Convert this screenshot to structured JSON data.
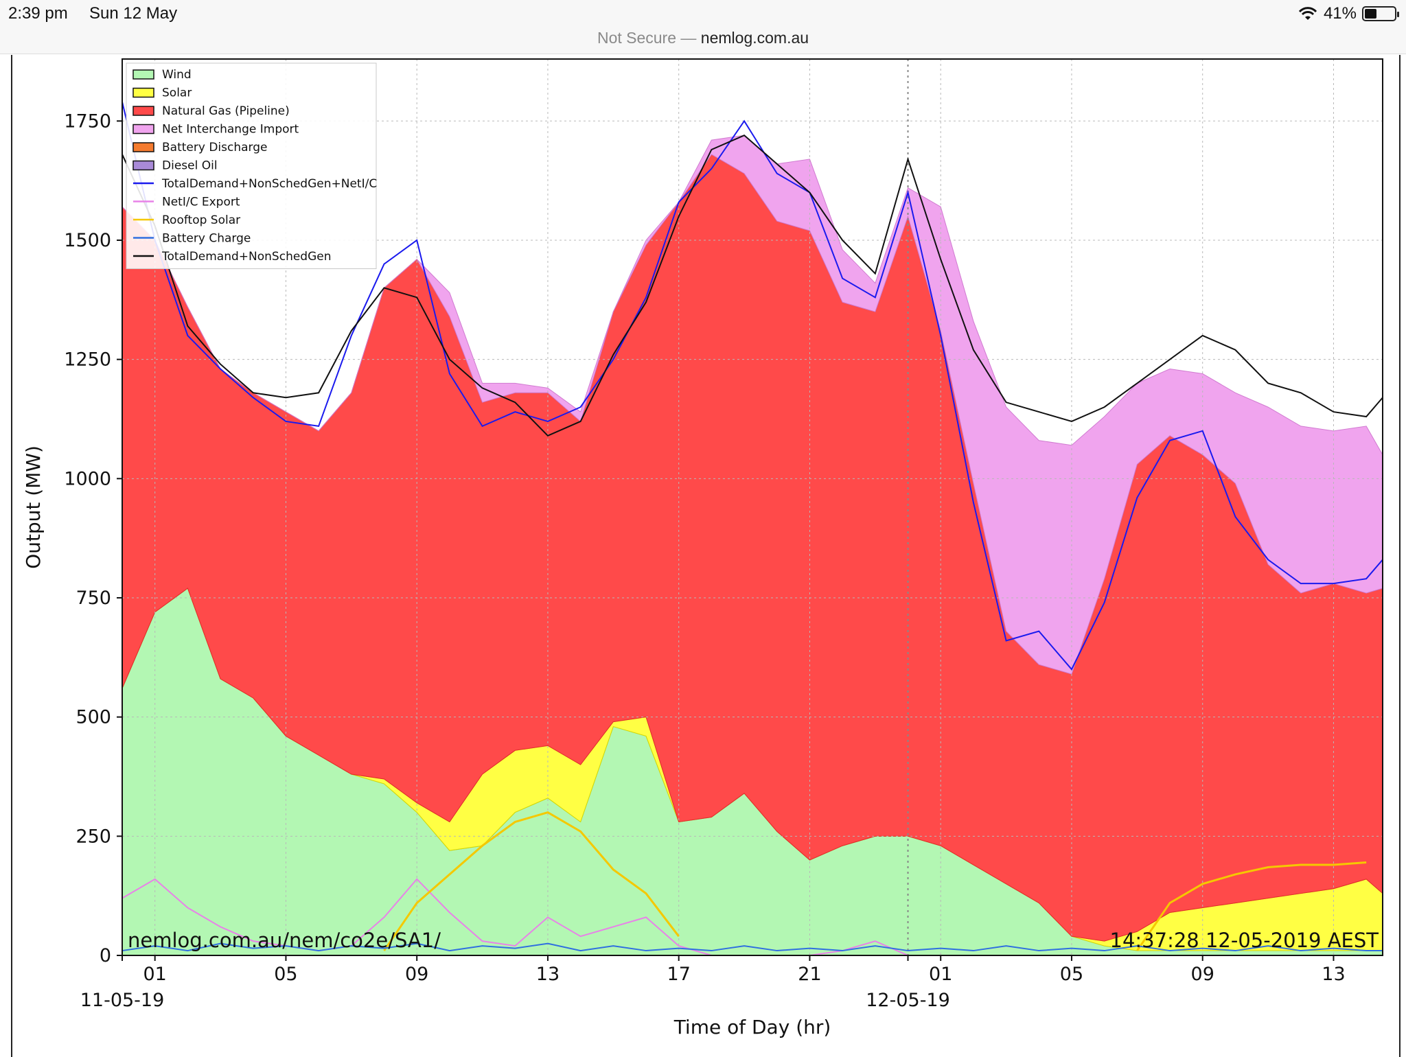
{
  "status": {
    "time": "2:39 pm",
    "date": "Sun 12 May",
    "battery": "41%",
    "battery_level": 0.41
  },
  "browser": {
    "insecure_label": "Not Secure —",
    "host": "nemlog.com.au"
  },
  "chart_data": {
    "type": "area",
    "xlabel": "Time of Day (hr)",
    "ylabel": "Output (MW)",
    "ylim": [
      0,
      1880
    ],
    "yticks": [
      0,
      250,
      500,
      750,
      1000,
      1250,
      1500,
      1750
    ],
    "xlim": [
      0,
      38.5
    ],
    "xticks": [
      {
        "x": 1,
        "label": "01"
      },
      {
        "x": 5,
        "label": "05"
      },
      {
        "x": 9,
        "label": "09"
      },
      {
        "x": 13,
        "label": "13"
      },
      {
        "x": 17,
        "label": "17"
      },
      {
        "x": 21,
        "label": "21"
      },
      {
        "x": 25,
        "label": "01"
      },
      {
        "x": 29,
        "label": "05"
      },
      {
        "x": 33,
        "label": "09"
      },
      {
        "x": 37,
        "label": "13"
      }
    ],
    "date_labels": [
      {
        "x": 0,
        "label": "11-05-19"
      },
      {
        "x": 24,
        "label": "12-05-19"
      }
    ],
    "grid": true,
    "legend_position": "top-left",
    "watermark_left": "nemlog.com.au/nem/co2e/SA1/",
    "watermark_right": "14:37:28 12-05-2019 AEST",
    "x": [
      0,
      1,
      2,
      3,
      4,
      5,
      6,
      7,
      8,
      9,
      10,
      11,
      12,
      13,
      14,
      15,
      16,
      17,
      18,
      19,
      20,
      21,
      22,
      23,
      24,
      25,
      26,
      27,
      28,
      29,
      30,
      31,
      32,
      33,
      34,
      35,
      36,
      37,
      38,
      38.5
    ],
    "series": [
      {
        "name": "Wind",
        "kind": "area",
        "color": "#b3f7b3",
        "edge": "#7ccf7c",
        "values": [
          560,
          720,
          770,
          580,
          540,
          460,
          420,
          380,
          360,
          300,
          220,
          230,
          300,
          330,
          280,
          480,
          460,
          280,
          290,
          340,
          260,
          200,
          230,
          250,
          250,
          230,
          190,
          150,
          110,
          40,
          20,
          10,
          10,
          10,
          10,
          10,
          10,
          10,
          10,
          10
        ]
      },
      {
        "name": "Solar",
        "kind": "area",
        "color": "#ffff44",
        "edge": "#d6d600",
        "values": [
          0,
          0,
          0,
          0,
          0,
          0,
          0,
          0,
          10,
          20,
          60,
          150,
          130,
          110,
          120,
          10,
          40,
          0,
          0,
          0,
          0,
          0,
          0,
          0,
          0,
          0,
          0,
          0,
          0,
          0,
          10,
          40,
          80,
          90,
          100,
          110,
          120,
          130,
          150,
          120
        ]
      },
      {
        "name": "Natural Gas (Pipeline)",
        "kind": "area",
        "color": "#ff4a4a",
        "edge": "#e02a2a",
        "values": [
          1010,
          780,
          590,
          650,
          640,
          680,
          680,
          800,
          1030,
          1140,
          1060,
          780,
          750,
          740,
          720,
          860,
          990,
          1300,
          1390,
          1300,
          1280,
          1320,
          1140,
          1100,
          1300,
          1080,
          800,
          530,
          500,
          550,
          760,
          980,
          1000,
          950,
          880,
          700,
          630,
          640,
          600,
          640
        ]
      },
      {
        "name": "Net Interchange Import",
        "kind": "area",
        "color": "#f0a4ee",
        "edge": "#d07ad0",
        "values": [
          0,
          0,
          0,
          0,
          0,
          0,
          0,
          0,
          0,
          0,
          50,
          40,
          20,
          10,
          20,
          0,
          10,
          0,
          30,
          80,
          120,
          150,
          110,
          60,
          60,
          260,
          340,
          470,
          470,
          480,
          340,
          170,
          140,
          170,
          190,
          330,
          350,
          320,
          350,
          280
        ]
      },
      {
        "name": "Battery Discharge",
        "kind": "area",
        "color": "#f47b2f",
        "edge": "#c85c15",
        "values": []
      },
      {
        "name": "Diesel Oil",
        "kind": "area",
        "color": "#a98ad8",
        "edge": "#7b5ab8",
        "values": []
      },
      {
        "name": "TotalDemand+NonSchedGen+NetI/C",
        "kind": "line",
        "color": "#1a1aee",
        "values": [
          1790,
          1500,
          1300,
          1230,
          1170,
          1120,
          1110,
          1300,
          1450,
          1500,
          1220,
          1110,
          1140,
          1120,
          1150,
          1250,
          1380,
          1580,
          1650,
          1750,
          1640,
          1600,
          1420,
          1380,
          1600,
          1300,
          950,
          660,
          680,
          600,
          740,
          960,
          1080,
          1100,
          920,
          830,
          780,
          780,
          790,
          830
        ]
      },
      {
        "name": "NetI/C Export",
        "kind": "line",
        "color": "#e882e8",
        "values": [
          120,
          160,
          100,
          60,
          30,
          20,
          10,
          20,
          80,
          160,
          90,
          30,
          20,
          80,
          40,
          60,
          80,
          20,
          0,
          0,
          0,
          0,
          10,
          30,
          0,
          0,
          0,
          0,
          0,
          0,
          0,
          0,
          0,
          0,
          0,
          0,
          0,
          0,
          0,
          0
        ]
      },
      {
        "name": "Rooftop Solar",
        "kind": "line",
        "color": "#f5c800",
        "values": [
          null,
          null,
          null,
          null,
          null,
          null,
          null,
          null,
          10,
          110,
          170,
          230,
          280,
          300,
          260,
          180,
          130,
          40,
          null,
          null,
          null,
          null,
          null,
          null,
          null,
          null,
          null,
          null,
          null,
          null,
          null,
          10,
          110,
          150,
          170,
          185,
          190,
          190,
          195,
          null
        ]
      },
      {
        "name": "Battery Charge",
        "kind": "line",
        "color": "#2f6fe0",
        "values": [
          10,
          20,
          10,
          25,
          15,
          20,
          10,
          20,
          15,
          25,
          10,
          20,
          15,
          25,
          10,
          20,
          10,
          15,
          10,
          20,
          10,
          15,
          10,
          20,
          10,
          15,
          10,
          20,
          10,
          15,
          10,
          20,
          10,
          15,
          10,
          20,
          10,
          15,
          10,
          10
        ]
      },
      {
        "name": "TotalDemand+NonSchedGen",
        "kind": "line",
        "color": "#111111",
        "values": [
          1680,
          1530,
          1320,
          1240,
          1180,
          1170,
          1180,
          1310,
          1400,
          1380,
          1250,
          1190,
          1160,
          1090,
          1120,
          1260,
          1370,
          1550,
          1690,
          1720,
          1660,
          1600,
          1500,
          1430,
          1670,
          1460,
          1270,
          1160,
          1140,
          1120,
          1150,
          1200,
          1250,
          1300,
          1270,
          1200,
          1180,
          1140,
          1130,
          1170
        ]
      }
    ]
  }
}
